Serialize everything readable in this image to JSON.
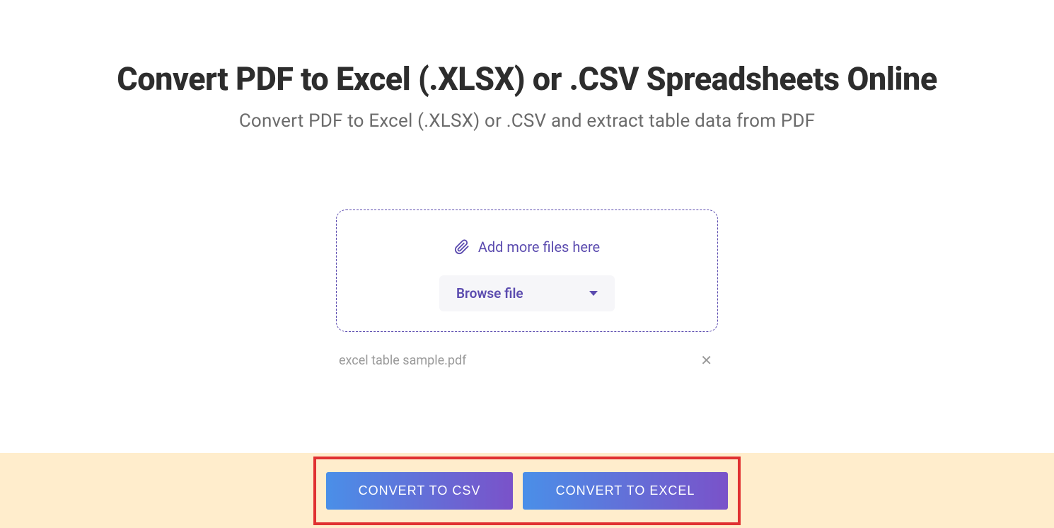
{
  "header": {
    "title": "Convert PDF to Excel (.XLSX) or .CSV Spreadsheets Online",
    "subtitle": "Convert PDF to Excel (.XLSX) or .CSV and extract table data from PDF"
  },
  "upload": {
    "add_more_label": "Add more files here",
    "browse_label": "Browse file"
  },
  "files": [
    {
      "name": "excel table sample.pdf"
    }
  ],
  "actions": {
    "convert_csv_label": "CONVERT TO CSV",
    "convert_excel_label": "CONVERT TO EXCEL"
  },
  "colors": {
    "accent": "#5b4baf",
    "highlight_border": "#e03131",
    "bottom_bar_bg": "#ffedcc",
    "button_gradient_start": "#4a8fe8",
    "button_gradient_end": "#7a52c9"
  }
}
